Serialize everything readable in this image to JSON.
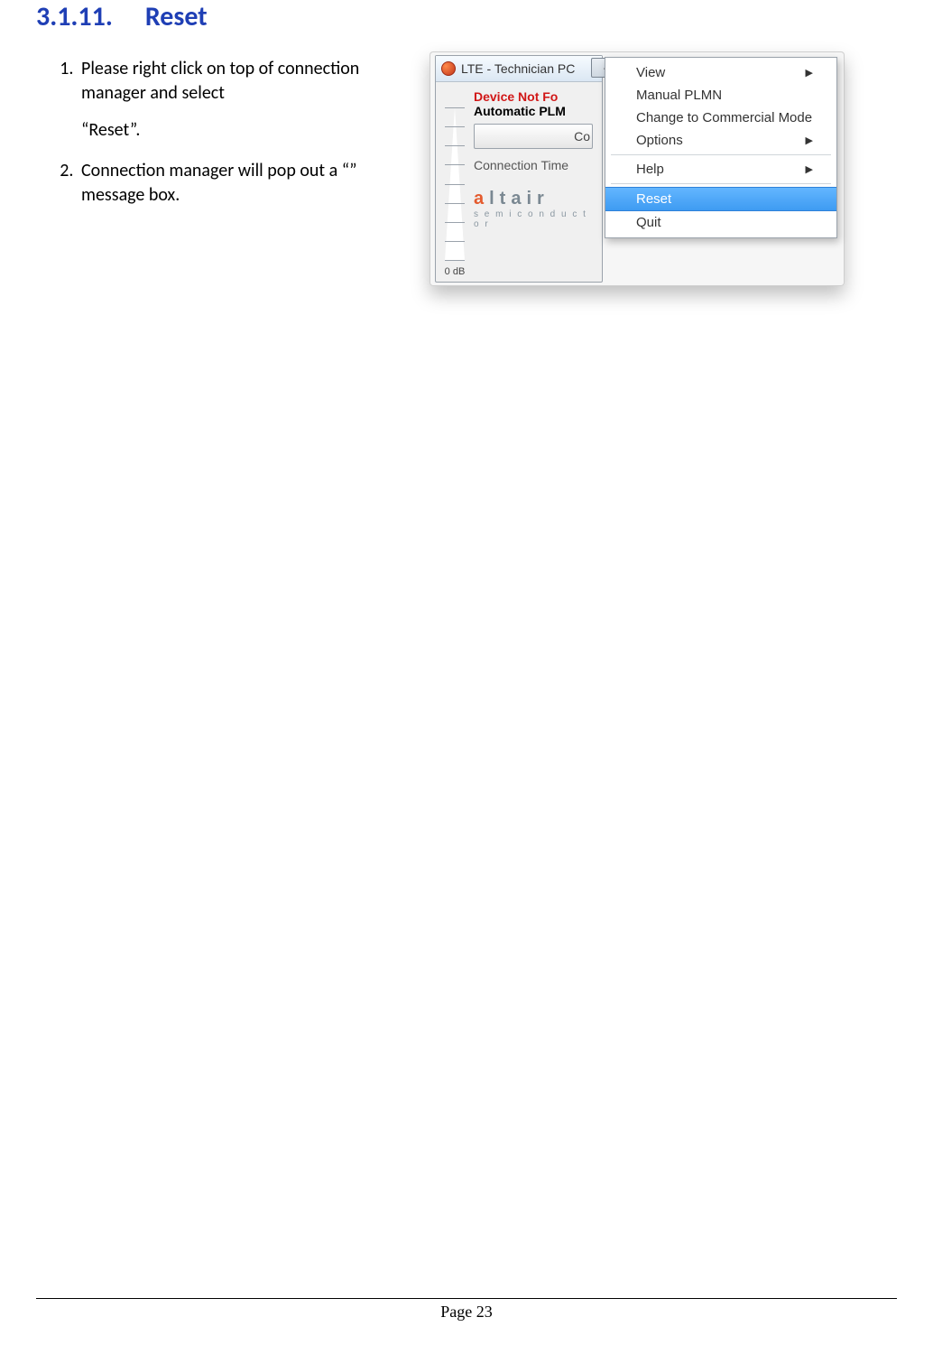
{
  "heading": {
    "number": "3.1.11.",
    "title": "Reset"
  },
  "steps": [
    {
      "num": "1.",
      "text": "Please right click on top of connection manager and select",
      "sub": "“Reset”."
    },
    {
      "num": "2.",
      "text": "Connection manager will pop out a “” message box."
    }
  ],
  "window": {
    "title": "LTE - Technician PC",
    "device_not_found": "Device Not Fo",
    "automatic_plmn": "Automatic PLM",
    "connect_button_visible": "Co",
    "connection_time_label": "Connection Time",
    "signal_label": "0 dB",
    "brand_main": "altair",
    "brand_sub": "s e m i c o n d u c t o r"
  },
  "winctrl": {
    "minimize": "–",
    "maximize": "□",
    "close": "×"
  },
  "context_menu": {
    "items": [
      {
        "label": "View",
        "has_submenu": true,
        "selected": false
      },
      {
        "label": "Manual PLMN",
        "has_submenu": false,
        "selected": false
      },
      {
        "label": "Change to Commercial Mode",
        "has_submenu": false,
        "selected": false
      },
      {
        "label": "Options",
        "has_submenu": true,
        "selected": false
      },
      {
        "sep": true
      },
      {
        "label": "Help",
        "has_submenu": true,
        "selected": false
      },
      {
        "sep": true
      },
      {
        "label": "Reset",
        "has_submenu": false,
        "selected": true
      },
      {
        "label": "Quit",
        "has_submenu": false,
        "selected": false
      }
    ],
    "arrow": "▶"
  },
  "footer": "Page 23"
}
